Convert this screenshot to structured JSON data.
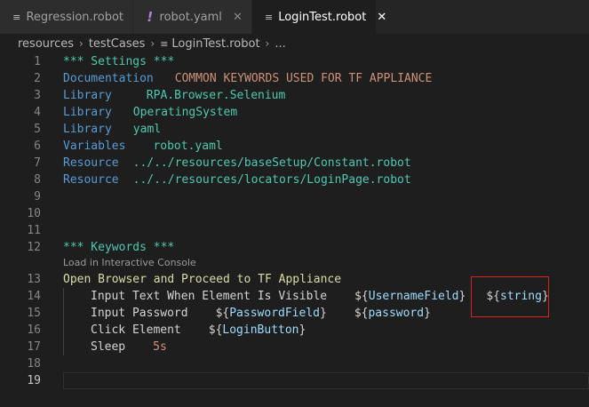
{
  "tabs": [
    {
      "label": "Regression.robot",
      "icon": "file-lines-icon",
      "active": false
    },
    {
      "label": "robot.yaml",
      "icon": "exclamation-icon",
      "active": false
    },
    {
      "label": "LoginTest.robot",
      "icon": "file-lines-icon",
      "active": true
    }
  ],
  "breadcrumb": {
    "items": [
      "resources",
      "testCases",
      "LoginTest.robot",
      "..."
    ]
  },
  "editor": {
    "line_numbers": [
      "1",
      "2",
      "3",
      "4",
      "5",
      "6",
      "7",
      "8",
      "9",
      "10",
      "11",
      "12",
      "13",
      "14",
      "15",
      "16",
      "17",
      "18",
      "19"
    ],
    "codelens": "Load in Interactive Console",
    "lines": {
      "l1": "*** Settings ***",
      "l2_key": "Documentation",
      "l2_val": "COMMON KEYWORDS USED FOR TF APPLIANCE",
      "l3_key": "Library",
      "l3_val": "RPA.Browser.Selenium",
      "l4_key": "Library",
      "l4_val": "OperatingSystem",
      "l5_key": "Library",
      "l5_val": "yaml",
      "l6_key": "Variables",
      "l6_val": "robot.yaml",
      "l7_key": "Resource",
      "l7_val": "../../resources/baseSetup/Constant.robot",
      "l8_key": "Resource",
      "l8_val": "../../resources/locators/LoginPage.robot",
      "l12": "*** Keywords ***",
      "l13": "Open Browser and Proceed to TF Appliance",
      "l14_kw": "Input Text When Element Is Visible",
      "l14_a1_name": "UsernameField",
      "l14_a2_name": "string",
      "l15_kw": "Input Password",
      "l15_a1_name": "PasswordField",
      "l15_a2_name": "password",
      "l16_kw": "Click Element",
      "l16_a1_name": "LoginButton",
      "l17_kw": "Sleep",
      "l17_arg": "5s"
    },
    "var_open": "${",
    "var_close": "}"
  },
  "colors": {
    "background": "#1e1e1e",
    "highlight_box": "#d9231b",
    "setting_header": "#4ec9b0",
    "setting_key": "#569cd6",
    "variable_name": "#9cdcfe"
  }
}
